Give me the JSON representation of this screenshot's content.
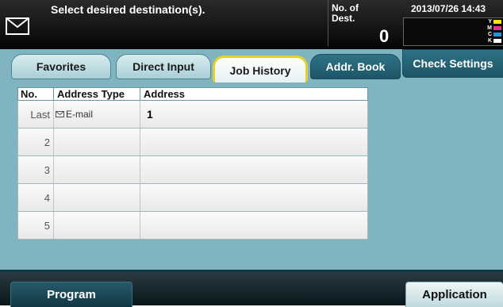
{
  "header": {
    "prompt": "Select desired destination(s).",
    "dest_label": "No. of\nDest.",
    "dest_count": "0",
    "datetime": "2013/07/26 14:43",
    "toner_labels": [
      "Y",
      "M",
      "C",
      "K"
    ],
    "toner_colors": [
      "#f2e21a",
      "#e2338e",
      "#1f98d8",
      "#ffffff"
    ]
  },
  "tabs": [
    {
      "label": "Favorites"
    },
    {
      "label": "Direct Input"
    },
    {
      "label": "Job History"
    },
    {
      "label": "Addr. Book"
    }
  ],
  "active_tab": "Job History",
  "check_settings_label": "Check Settings",
  "table": {
    "headers": [
      "No.",
      "Address Type",
      "Address"
    ],
    "rows": [
      {
        "no": "Last",
        "type": "E-mail",
        "address": "1"
      },
      {
        "no": "2",
        "type": "",
        "address": ""
      },
      {
        "no": "3",
        "type": "",
        "address": ""
      },
      {
        "no": "4",
        "type": "",
        "address": ""
      },
      {
        "no": "5",
        "type": "",
        "address": ""
      }
    ]
  },
  "footer": {
    "program_label": "Program",
    "application_label": "Application"
  },
  "colors": {
    "panel": "#7fb4c0",
    "active_tab_border": "#e6cf2a",
    "dark_button": "#1d5567"
  }
}
